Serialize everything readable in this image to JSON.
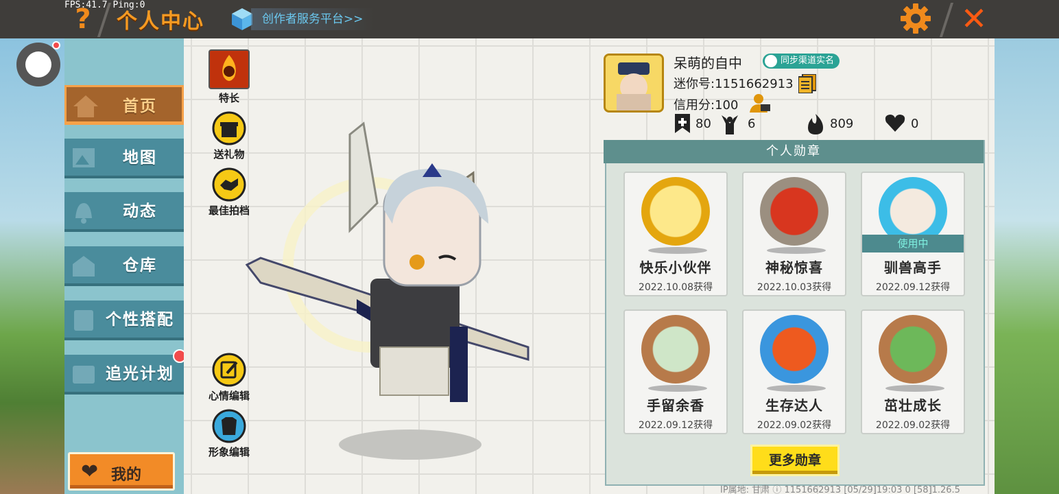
{
  "debug": {
    "fps": "FPS:41.7 Ping:0"
  },
  "header": {
    "help": "?",
    "title": "个人中心",
    "creator_link": "创作者服务平台>>",
    "close": "✕"
  },
  "sidebar": {
    "items": [
      {
        "label": "首页",
        "active": true
      },
      {
        "label": "地图",
        "active": false
      },
      {
        "label": "动态",
        "active": false
      },
      {
        "label": "仓库",
        "active": false
      },
      {
        "label": "个性搭配",
        "active": false
      },
      {
        "label": "追光计划",
        "active": false
      }
    ],
    "mine_button": "我的"
  },
  "actions": {
    "specialty": "特长",
    "send_gift": "送礼物",
    "best_partner": "最佳拍档",
    "mood_edit": "心情编辑",
    "image_edit": "形象编辑"
  },
  "profile": {
    "nickname": "呆萌的自中",
    "sync_badge": "同步渠道实名",
    "mini_id": "迷你号:1151662913",
    "credit": "信用分:100",
    "stats": {
      "collect": "80",
      "fans": "6",
      "heat": "809",
      "likes": "0"
    }
  },
  "medals": {
    "title": "个人勋章",
    "items": [
      {
        "name": "快乐小伙伴",
        "date": "2022.10.08获得",
        "in_use": ""
      },
      {
        "name": "神秘惊喜",
        "date": "2022.10.03获得",
        "in_use": ""
      },
      {
        "name": "驯兽高手",
        "date": "2022.09.12获得",
        "in_use": "使用中"
      },
      {
        "name": "手留余香",
        "date": "2022.09.12获得",
        "in_use": ""
      },
      {
        "name": "生存达人",
        "date": "2022.09.02获得",
        "in_use": ""
      },
      {
        "name": "茁壮成长",
        "date": "2022.09.02获得",
        "in_use": ""
      }
    ],
    "more_button": "更多勋章"
  },
  "footer": {
    "text": "IP属地: 甘肃 ⓘ     1151662913    [05/29]19:03 0  [58]1.26.5"
  },
  "colors": {
    "accent_orange": "#f59a22",
    "nav_teal": "#4a8c9c",
    "medal_header": "#5e8f8d",
    "more_button": "#ffdd1a"
  }
}
